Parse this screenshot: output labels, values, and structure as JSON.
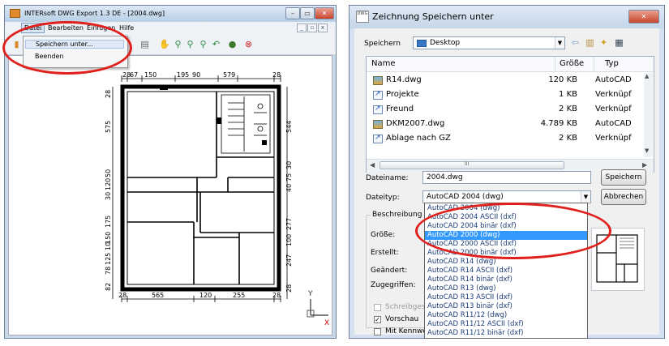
{
  "left_window": {
    "title": "INTERsoft DWG Export 1.3 DE - [2004.dwg]",
    "caption_buttons": [
      "minimize",
      "maximize",
      "close"
    ],
    "menu": {
      "datei": "Datei",
      "bearbeiten": "Bearbeiten",
      "einfuegen": "Einfügen",
      "hilfe": "Hilfe"
    },
    "file_menu": {
      "save_as": "Speichern unter...",
      "exit": "Beenden"
    },
    "mdi_buttons": [
      "_",
      "▫",
      "x"
    ],
    "dimensions": {
      "top": [
        "28",
        "67",
        "150",
        "195",
        "90",
        "579",
        "28"
      ],
      "bottom": [
        "28",
        "565",
        "120",
        "255",
        "28"
      ],
      "left": [
        "28",
        "575",
        "50",
        "120",
        "30",
        "175",
        "150",
        "10",
        "125",
        "78",
        "82",
        "28",
        "150",
        "28"
      ],
      "right": [
        "544",
        "30",
        "75",
        "40",
        "277",
        "100",
        "247",
        "28"
      ]
    },
    "axis": {
      "y": "Y",
      "x": "X"
    }
  },
  "right_window": {
    "title": "Zeichnung Speichern unter",
    "icon_label": "DWG",
    "save_in_label": "Speichern",
    "save_in_value": "Desktop",
    "columns": {
      "name": "Name",
      "size": "Größe",
      "type": "Typ"
    },
    "files": [
      {
        "icon": "dwg",
        "name": "R14.dwg",
        "size": "120 KB",
        "type": "AutoCAD"
      },
      {
        "icon": "lnk",
        "name": "Projekte",
        "size": "1 KB",
        "type": "Verknüpf"
      },
      {
        "icon": "lnk",
        "name": "Freund",
        "size": "2 KB",
        "type": "Verknüpf"
      },
      {
        "icon": "dwg",
        "name": "DKM2007.dwg",
        "size": "4.789 KB",
        "type": "AutoCAD"
      },
      {
        "icon": "lnk",
        "name": "Ablage nach GZ",
        "size": "2 KB",
        "type": "Verknüpf"
      }
    ],
    "scroll_marker": "III",
    "filename_label": "Dateiname:",
    "filename_value": "2004.dwg",
    "filetype_label": "Dateityp:",
    "filetype_value": "AutoCAD 2004 (dwg)",
    "save_button": "Speichern",
    "cancel_button": "Abbrechen",
    "description_label": "Beschreibung",
    "info_labels": [
      "Größe:",
      "Erstellt:",
      "Geändert:",
      "Zugegriffen:"
    ],
    "checkboxes": [
      {
        "label": "Schreibgeschützt",
        "checked": false
      },
      {
        "label": "Vorschau",
        "checked": true
      },
      {
        "label": "Mit Kennwort",
        "checked": false
      }
    ],
    "filetype_options": [
      "AutoCAD 2004 (dwg)",
      "AutoCAD 2004 ASCII (dxf)",
      "AutoCAD 2004 binär (dxf)",
      "AutoCAD 2000 (dwg)",
      "AutoCAD 2000 ASCII (dxf)",
      "AutoCAD 2000 binär (dxf)",
      "AutoCAD R14 (dwg)",
      "AutoCAD R14 ASCII (dxf)",
      "AutoCAD R14 binär (dxf)",
      "AutoCAD R13 (dwg)",
      "AutoCAD R13 ASCII (dxf)",
      "AutoCAD R13 binär (dxf)",
      "AutoCAD R11/12 (dwg)",
      "AutoCAD R11/12 ASCII (dxf)",
      "AutoCAD R11/12 binär (dxf)"
    ],
    "highlighted_option": "AutoCAD 2000 (dwg)"
  },
  "colors": {
    "highlight": "#3399ff",
    "annotation": "#e0201c"
  }
}
